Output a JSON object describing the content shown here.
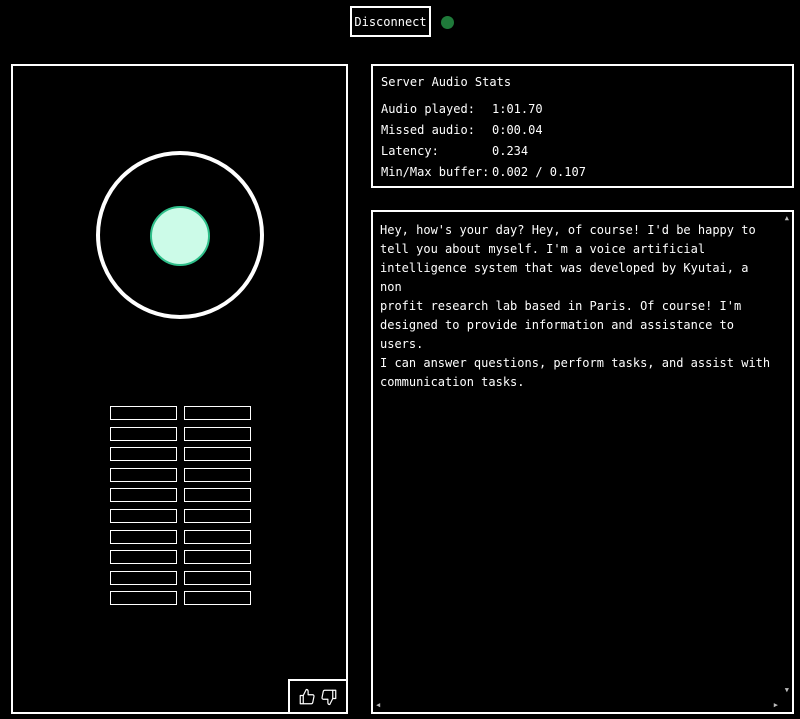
{
  "header": {
    "disconnect_label": "Disconnect",
    "status_color": "#1f7a3a"
  },
  "visualizer": {
    "ring_color": "#ffffff",
    "core_color": "#ccfbe8",
    "meter_rows": 10,
    "meter_columns": 2,
    "feedback": {
      "thumbs_up_icon": "thumbs-up-icon",
      "thumbs_down_icon": "thumbs-down-icon"
    }
  },
  "stats": {
    "title": "Server Audio Stats",
    "rows": [
      {
        "label": "Audio played:",
        "value": "1:01.70"
      },
      {
        "label": "Missed audio:",
        "value": "0:00.04"
      },
      {
        "label": "Latency:",
        "value": "0.234"
      },
      {
        "label": "Min/Max buffer:",
        "value": "0.002 / 0.107"
      }
    ]
  },
  "transcript": {
    "lines": [
      "Hey, how's your day? Hey, of course! I'd be happy to",
      "tell you about myself. I'm a voice artificial",
      "intelligence system that was developed by Kyutai, a non",
      "profit research lab based in Paris. Of course! I'm",
      "designed to provide information and assistance to users.",
      "I can answer questions, perform tasks, and assist with",
      "communication tasks."
    ]
  }
}
